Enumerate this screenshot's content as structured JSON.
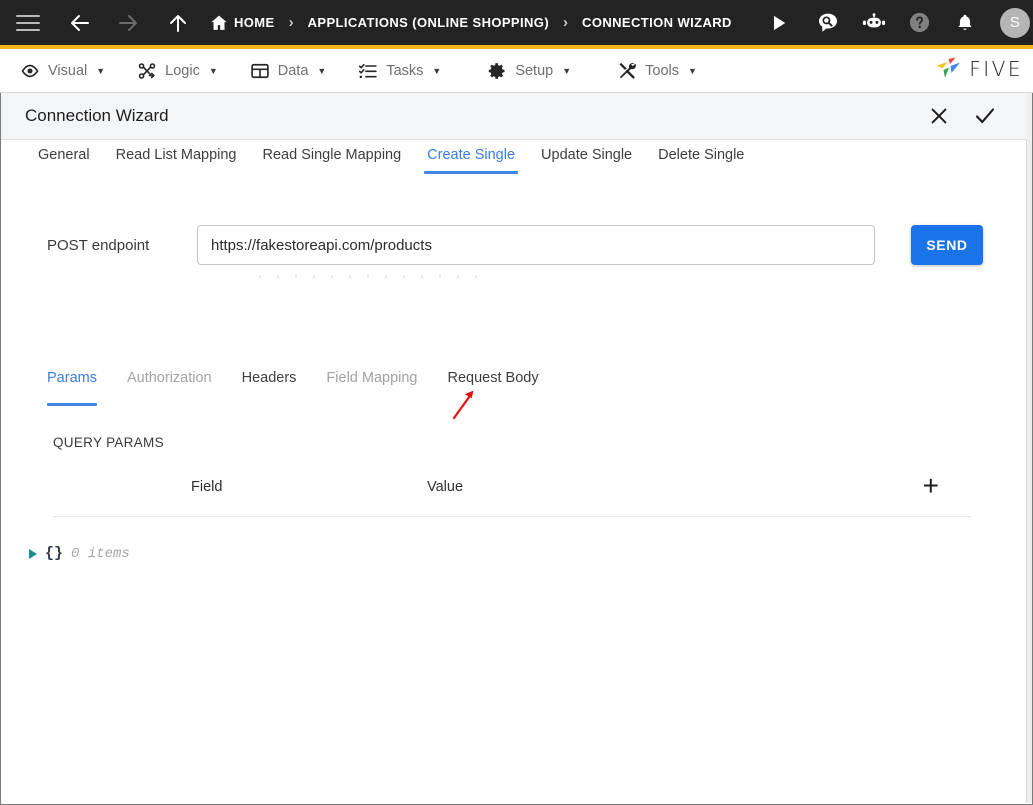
{
  "topbar": {
    "icons": {
      "menu": "hamburger-icon",
      "back": "back-arrow-icon",
      "forward": "forward-arrow-icon",
      "up": "up-arrow-icon",
      "home": "home-icon",
      "run": "play-icon",
      "search_chat": "search-bubble-icon",
      "bot": "robot-icon",
      "help": "help-circle-icon",
      "notifications": "bell-icon"
    },
    "breadcrumbs": [
      {
        "label": "HOME"
      },
      {
        "label": "APPLICATIONS (ONLINE SHOPPING)"
      },
      {
        "label": "CONNECTION WIZARD"
      }
    ],
    "separator": "›",
    "avatar_initial": "S",
    "background": "#232323",
    "accent_color": "#f2b417"
  },
  "menubar": {
    "items": [
      {
        "label": "Visual",
        "icon": "eye-icon"
      },
      {
        "label": "Logic",
        "icon": "logic-nodes-icon"
      },
      {
        "label": "Data",
        "icon": "table-grid-icon"
      },
      {
        "label": "Tasks",
        "icon": "checklist-icon"
      },
      {
        "label": "Setup",
        "icon": "gear-icon"
      },
      {
        "label": "Tools",
        "icon": "tools-icon"
      }
    ],
    "caret": "▼",
    "logo_text": "FIVE"
  },
  "wizard": {
    "title": "Connection Wizard",
    "close_icon": "close-x-icon",
    "confirm_icon": "checkmark-icon"
  },
  "main_tabs": [
    {
      "label": "General",
      "active": false
    },
    {
      "label": "Read List Mapping",
      "active": false
    },
    {
      "label": "Read Single Mapping",
      "active": false
    },
    {
      "label": "Create Single",
      "active": true
    },
    {
      "label": "Update Single",
      "active": false
    },
    {
      "label": "Delete Single",
      "active": false
    }
  ],
  "endpoint": {
    "label": "POST endpoint",
    "value": "https://fakestoreapi.com/products",
    "placeholder": "",
    "send_label": "SEND",
    "send_color": "#1a73e8"
  },
  "sub_tabs": [
    {
      "label": "Params",
      "state": "active"
    },
    {
      "label": "Authorization",
      "state": "dim"
    },
    {
      "label": "Headers",
      "state": "normal"
    },
    {
      "label": "Field Mapping",
      "state": "dim"
    },
    {
      "label": "Request Body",
      "state": "normal"
    }
  ],
  "query_params": {
    "title": "QUERY PARAMS",
    "columns": [
      "Field",
      "Value"
    ],
    "add_label": "+",
    "rows": []
  },
  "json_viewer": {
    "braces": "{}",
    "count_label": "0 items",
    "expander_color": "#1c8c8c"
  },
  "annotation": {
    "arrow_color": "#e51414",
    "points_to": "Request Body"
  }
}
